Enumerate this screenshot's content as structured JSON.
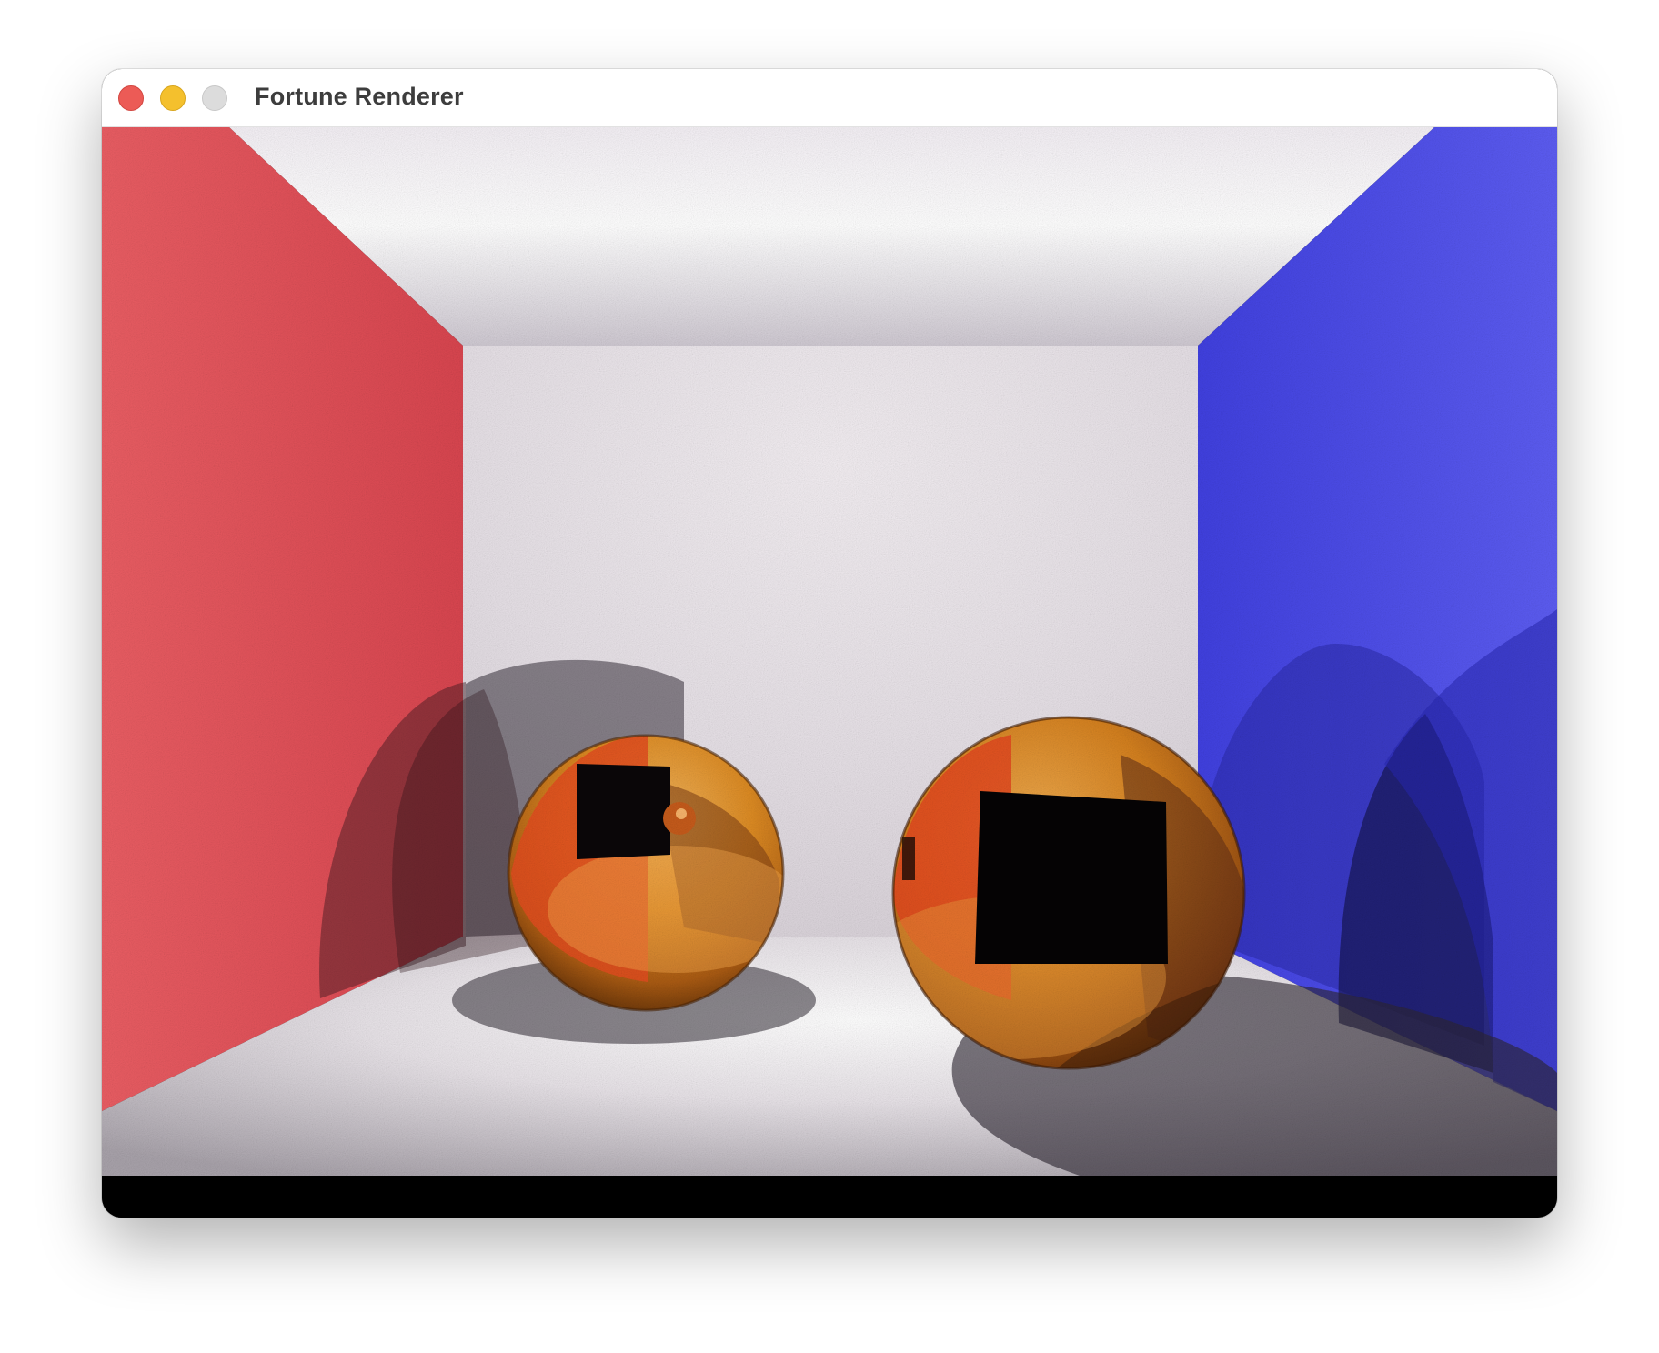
{
  "window": {
    "title": "Fortune Renderer",
    "controls": {
      "close_color": "#ec5b56",
      "minimize_color": "#f4c02d",
      "zoom_color": "#dcdcdc"
    }
  },
  "render": {
    "scene": "cornell-box",
    "left_wall_color": "#e8505a",
    "right_wall_color": "#4b4bee",
    "neutral_color": "#ffffff",
    "sphere_material": "gold-metal",
    "sphere_color": "#e08a22"
  }
}
